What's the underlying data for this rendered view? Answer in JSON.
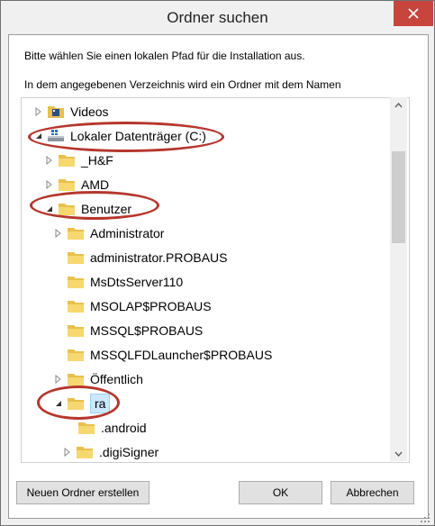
{
  "window": {
    "title": "Ordner suchen"
  },
  "messages": {
    "line1": "Bitte wählen Sie einen lokalen Pfad für die Installation aus.",
    "line2": "In dem angegebenen Verzeichnis wird ein Ordner mit dem Namen"
  },
  "tree": {
    "items": [
      {
        "label": "Videos",
        "expander": "collapsed",
        "icon": "video-folder-icon"
      },
      {
        "label": "Lokaler Datenträger (C:)",
        "expander": "expanded",
        "icon": "drive-icon"
      },
      {
        "label": "_H&F",
        "expander": "collapsed",
        "icon": "folder-icon"
      },
      {
        "label": "AMD",
        "expander": "collapsed",
        "icon": "folder-icon"
      },
      {
        "label": "Benutzer",
        "expander": "expanded",
        "icon": "folder-icon"
      },
      {
        "label": "Administrator",
        "expander": "collapsed",
        "icon": "folder-icon"
      },
      {
        "label": "administrator.PROBAUS",
        "expander": "none",
        "icon": "folder-icon"
      },
      {
        "label": "MsDtsServer110",
        "expander": "none",
        "icon": "folder-icon"
      },
      {
        "label": "MSOLAP$PROBAUS",
        "expander": "none",
        "icon": "folder-icon"
      },
      {
        "label": "MSSQL$PROBAUS",
        "expander": "none",
        "icon": "folder-icon"
      },
      {
        "label": "MSSQLFDLauncher$PROBAUS",
        "expander": "none",
        "icon": "folder-icon"
      },
      {
        "label": "Öffentlich",
        "expander": "collapsed",
        "icon": "folder-icon"
      },
      {
        "label": "ra",
        "expander": "expanded",
        "icon": "folder-icon",
        "selected": true
      },
      {
        "label": ".android",
        "expander": "none",
        "icon": "folder-icon"
      },
      {
        "label": ".digiSigner",
        "expander": "collapsed",
        "icon": "folder-icon"
      }
    ]
  },
  "buttons": {
    "new_folder": "Neuen Ordner erstellen",
    "ok": "OK",
    "cancel": "Abbrechen"
  },
  "colors": {
    "highlight_oval": "#b5372d",
    "selection": "#cce8ff",
    "folder": "#e8c04c",
    "close_button": "#c7453c"
  }
}
